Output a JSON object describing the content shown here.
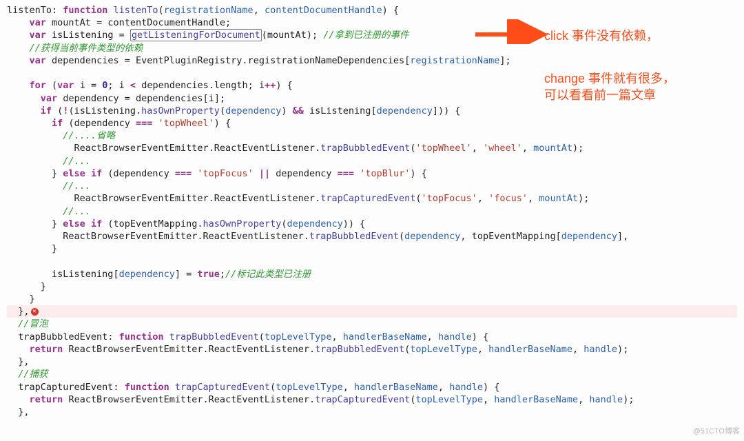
{
  "code": {
    "listenTo_name": "listenTo",
    "listenTo_fn": "listenTo",
    "param_registrationName": "registrationName",
    "param_contentDocumentHandle": "contentDocumentHandle",
    "mountAt": "mountAt",
    "contentDocumentHandle": "contentDocumentHandle",
    "isListening": "isListening",
    "getListeningForDocument": "getListeningForDocument",
    "cmt_registered": "//拿到已注册的事件",
    "cmt_deps": "//获得当前事件类型的依赖",
    "dependencies": "dependencies",
    "EventPluginRegistry": "EventPluginRegistry",
    "registrationNameDependencies": "registrationNameDependencies",
    "registrationName": "registrationName",
    "i": "i",
    "zero": "0",
    "dependency": "dependency",
    "hasOwnProperty": "hasOwnProperty",
    "topWheel": "'topWheel'",
    "cmt_omit": "//....省略",
    "ReactBrowserEventEmitter": "ReactBrowserEventEmitter",
    "ReactEventListener": "ReactEventListener",
    "trapBubbledEvent": "trapBubbledEvent",
    "wheel": "'wheel'",
    "cmt_dots": "//...",
    "topFocus": "'topFocus'",
    "topBlur": "'topBlur'",
    "trapCapturedEvent": "trapCapturedEvent",
    "focus": "'focus'",
    "topEventMapping": "topEventMapping",
    "true": "true",
    "cmt_mark": "//标记此类型已注册",
    "cmt_bubble": "//冒泡",
    "trapBubbledEvent2": "trapBubbledEvent",
    "topLevelType": "topLevelType",
    "handlerBaseName": "handlerBaseName",
    "handle": "handle",
    "cmt_capture": "//捕获",
    "trapCapturedEvent2": "trapCapturedEvent"
  },
  "annot": {
    "line1": "click 事件没有依赖，",
    "line2a": "change 事件就有很多，",
    "line2b": "可以看看前一篇文章"
  },
  "watermark": "@51CTO博客"
}
